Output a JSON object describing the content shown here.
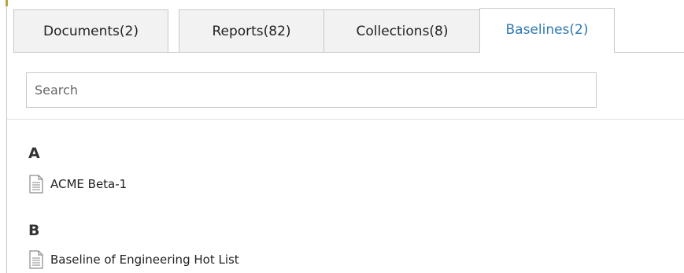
{
  "tabs": [
    {
      "label": "Documents(2)",
      "active": false
    },
    {
      "label": "Reports(82)",
      "active": false
    },
    {
      "label": "Collections(8)",
      "active": false
    },
    {
      "label": "Baselines(2)",
      "active": true
    }
  ],
  "search": {
    "placeholder": "Search",
    "value": ""
  },
  "groups": [
    {
      "letter": "A",
      "items": [
        {
          "label": "ACME Beta-1",
          "icon": "document-icon"
        }
      ]
    },
    {
      "letter": "B",
      "items": [
        {
          "label": "Baseline of Engineering Hot List",
          "icon": "document-icon"
        }
      ]
    }
  ],
  "colors": {
    "active_tab_text": "#2f78b3",
    "border": "#c8c8c8",
    "inactive_tab_bg": "#f2f2f2"
  }
}
